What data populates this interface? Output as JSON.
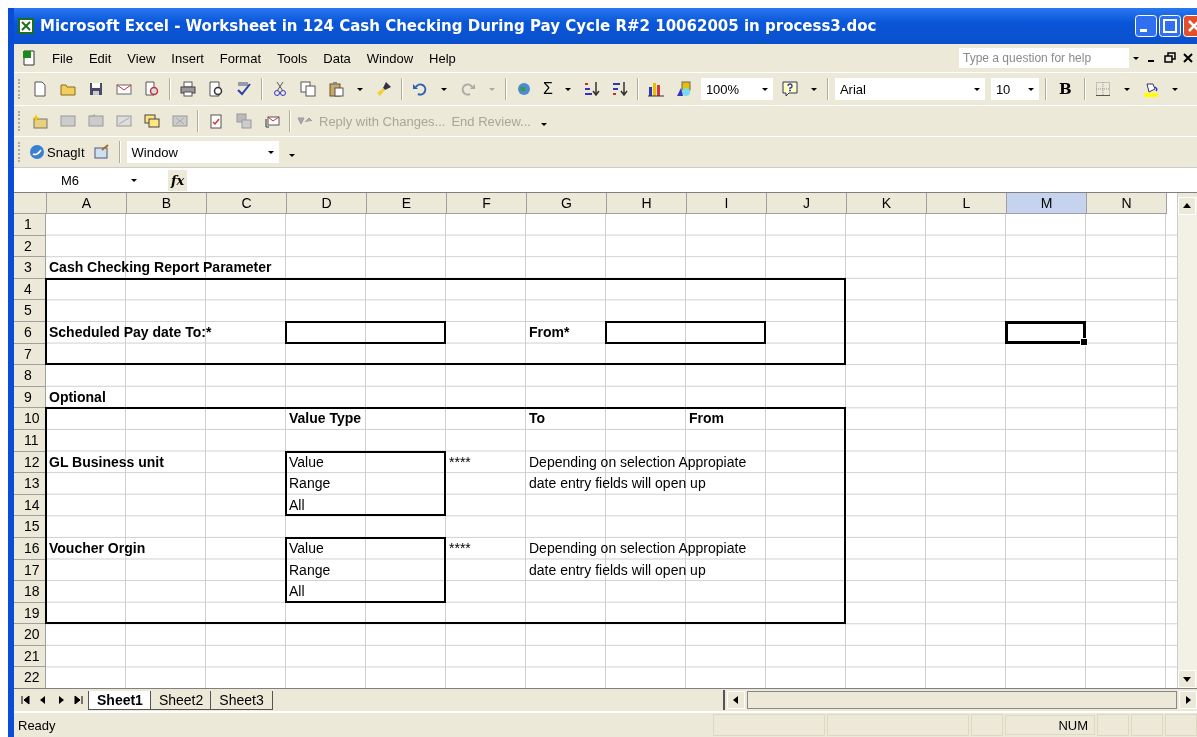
{
  "window": {
    "title": "Microsoft Excel - Worksheet in 124 Cash Checking During Pay Cycle R#2 10062005 in process3.doc"
  },
  "menu": [
    "File",
    "Edit",
    "View",
    "Insert",
    "Format",
    "Tools",
    "Data",
    "Window",
    "Help"
  ],
  "help_search": {
    "placeholder": "Type a question for help"
  },
  "standard_toolbar": {
    "sum_symbol": "Σ",
    "zoom": "100%",
    "font": "Arial",
    "font_size": "10",
    "bold_symbol": "B"
  },
  "reviewing_toolbar": {
    "reply": "Reply with Changes...",
    "end_review": "End Review..."
  },
  "snagit_toolbar": {
    "label": "SnagIt",
    "capture_mode": "Window"
  },
  "formula_bar": {
    "name_box": "M6",
    "fx": "fx"
  },
  "columns": [
    {
      "label": "A",
      "selected": false
    },
    {
      "label": "B",
      "selected": false
    },
    {
      "label": "C",
      "selected": false
    },
    {
      "label": "D",
      "selected": false
    },
    {
      "label": "E",
      "selected": false
    },
    {
      "label": "F",
      "selected": false
    },
    {
      "label": "G",
      "selected": false
    },
    {
      "label": "H",
      "selected": false
    },
    {
      "label": "I",
      "selected": false
    },
    {
      "label": "J",
      "selected": false
    },
    {
      "label": "K",
      "selected": false
    },
    {
      "label": "L",
      "selected": false
    },
    {
      "label": "M",
      "selected": true
    },
    {
      "label": "N",
      "selected": false
    }
  ],
  "rows": [
    {
      "header": "1"
    },
    {
      "header": "2"
    },
    {
      "header": "3",
      "cells": [
        {
          "text": "Cash Checking Report Parameter",
          "bold": true
        }
      ]
    },
    {
      "header": "4"
    },
    {
      "header": "5"
    },
    {
      "header": "6",
      "cells": [
        {
          "text": "Scheduled Pay date To:*",
          "bold": true
        },
        null,
        null,
        null,
        null,
        null,
        {
          "text": "From*",
          "bold": true
        }
      ]
    },
    {
      "header": "7"
    },
    {
      "header": "8"
    },
    {
      "header": "9",
      "cells": [
        {
          "text": "Optional",
          "bold": true
        }
      ]
    },
    {
      "header": "10",
      "cells": [
        null,
        null,
        null,
        {
          "text": "Value Type",
          "bold": true
        },
        null,
        null,
        {
          "text": "To",
          "bold": true
        },
        null,
        {
          "text": "From",
          "bold": true
        }
      ]
    },
    {
      "header": "11"
    },
    {
      "header": "12",
      "cells": [
        {
          "text": "GL Business unit",
          "bold": true
        },
        null,
        null,
        {
          "text": "Value",
          "bold": false
        },
        null,
        {
          "text": "****",
          "bold": false
        },
        {
          "text": "Depending on selection Appropiate",
          "bold": false
        }
      ]
    },
    {
      "header": "13",
      "cells": [
        null,
        null,
        null,
        {
          "text": "Range",
          "bold": false
        },
        null,
        null,
        {
          "text": "date entry fields will open up",
          "bold": false
        }
      ]
    },
    {
      "header": "14",
      "cells": [
        null,
        null,
        null,
        {
          "text": "All",
          "bold": false
        }
      ]
    },
    {
      "header": "15"
    },
    {
      "header": "16",
      "cells": [
        {
          "text": "Voucher Orgin",
          "bold": true
        },
        null,
        null,
        {
          "text": "Value",
          "bold": false
        },
        null,
        {
          "text": "****",
          "bold": false
        },
        {
          "text": "Depending on selection Appropiate",
          "bold": false
        }
      ]
    },
    {
      "header": "17",
      "cells": [
        null,
        null,
        null,
        {
          "text": "Range",
          "bold": false
        },
        null,
        null,
        {
          "text": "date entry fields will open up",
          "bold": false
        }
      ]
    },
    {
      "header": "18",
      "cells": [
        null,
        null,
        null,
        {
          "text": "All",
          "bold": false
        }
      ]
    },
    {
      "header": "19"
    },
    {
      "header": "20"
    },
    {
      "header": "21"
    },
    {
      "header": "22"
    }
  ],
  "sheet_tabs": [
    {
      "label": "Sheet1",
      "selected": true
    },
    {
      "label": "Sheet2",
      "selected": false
    },
    {
      "label": "Sheet3",
      "selected": false
    }
  ],
  "status_bar": {
    "status": "Ready",
    "indicator": "NUM"
  }
}
